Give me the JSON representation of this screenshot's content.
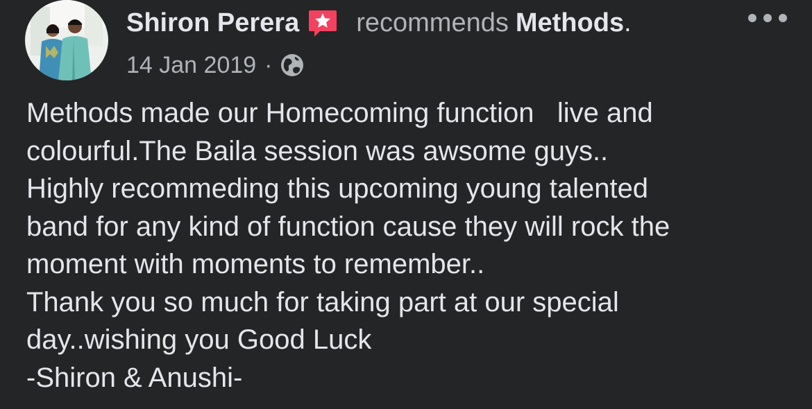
{
  "post": {
    "author": "Shiron Perera",
    "recommend_verb": "recommends",
    "page_name": "Methods",
    "period": ".",
    "date": "14 Jan 2019",
    "separator": "·",
    "privacy_icon": "globe-icon",
    "badge_icon": "recommendation-star-icon",
    "more_icon": "more-options-icon",
    "body_lines": [
      "Methods made our Homecoming function   live and",
      "colourful.The Baila session was awsome guys..",
      "Highly recommeding this upcoming young talented",
      "band for any kind of function cause they will rock the",
      "moment with moments to remember..",
      "Thank you so much for taking part at our special",
      "day..wishing you Good Luck",
      "-Shiron & Anushi-"
    ]
  },
  "colors": {
    "background": "#242526",
    "primary_text": "#e4e6eb",
    "secondary_text": "#b0b3b8",
    "badge": "#f3425f"
  }
}
